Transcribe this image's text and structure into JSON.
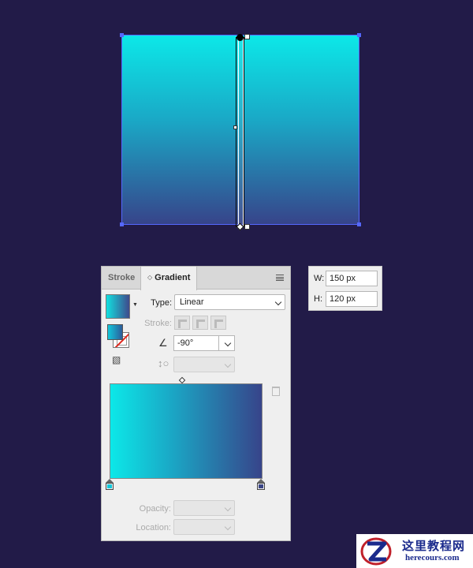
{
  "panel": {
    "tabs": [
      {
        "label": "Stroke",
        "active": false
      },
      {
        "label": "Gradient",
        "active": true
      }
    ],
    "type_label": "Type:",
    "type_value": "Linear",
    "stroke_label": "Stroke:",
    "angle_value": "-90°",
    "opacity_label": "Opacity:",
    "location_label": "Location:",
    "gradient_stops": [
      {
        "position": 0,
        "color": "#0ce8e8"
      },
      {
        "position": 100,
        "color": "#37448a"
      }
    ]
  },
  "transform": {
    "w_label": "W:",
    "w_value": "150 px",
    "h_label": "H:",
    "h_value": "120 px"
  },
  "artwork": {
    "gradient_top": "#0ce8e8",
    "gradient_bottom": "#37448a",
    "selection_color": "#5568ff"
  },
  "watermark": {
    "cn_text": "这里教程网",
    "en_text": "herecours.com"
  },
  "colors": {
    "background": "#221b48",
    "panel_bg": "#efefef"
  }
}
